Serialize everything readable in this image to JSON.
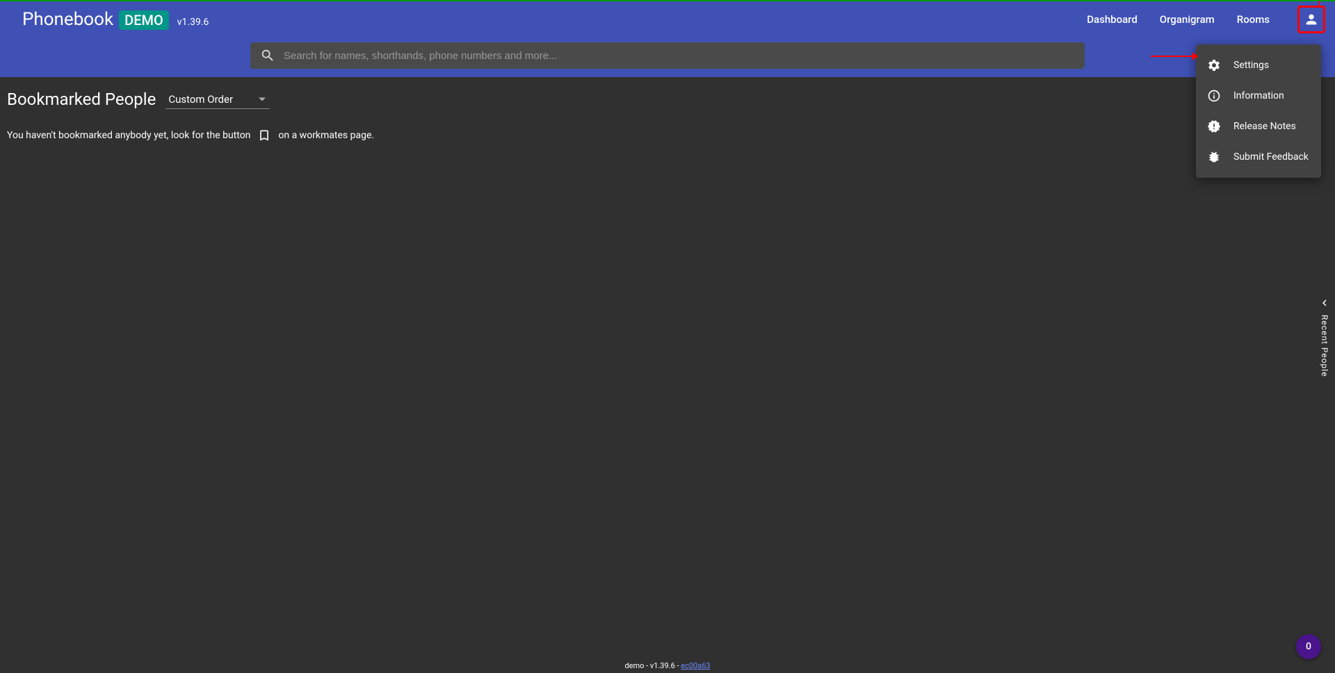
{
  "header": {
    "app_name": "Phonebook",
    "badge": "DEMO",
    "version": "v1.39.6",
    "nav": {
      "dashboard": "Dashboard",
      "organigram": "Organigram",
      "rooms": "Rooms"
    }
  },
  "search": {
    "placeholder": "Search for names, shorthands, phone numbers and more..."
  },
  "section": {
    "title": "Bookmarked People",
    "sort_value": "Custom Order",
    "empty_pre": "You haven't bookmarked anybody yet, look for the button",
    "empty_post": "on a workmates page."
  },
  "menu": {
    "settings": "Settings",
    "information": "Information",
    "release_notes": "Release Notes",
    "submit_feedback": "Submit Feedback"
  },
  "side_panel": {
    "label": "Recent People"
  },
  "badge": {
    "count": "0"
  },
  "footer": {
    "part1": "demo - v1.39.6 - ",
    "hash": "ec00a63"
  }
}
